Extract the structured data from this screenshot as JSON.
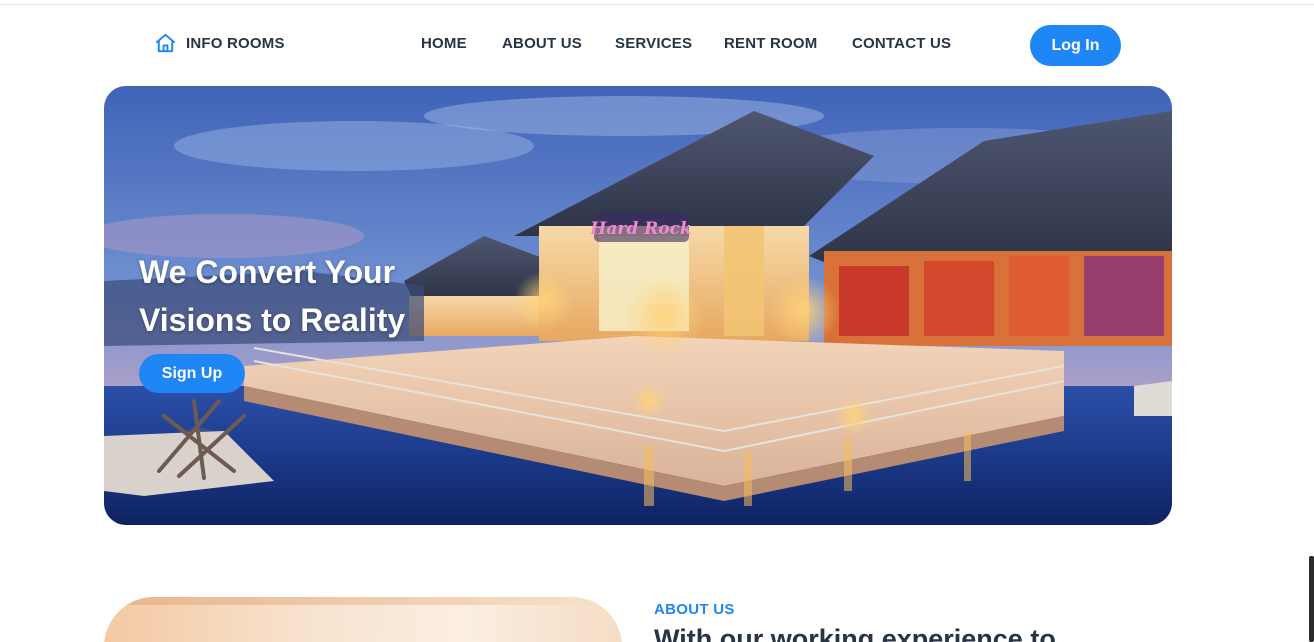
{
  "brand": {
    "name": "INFO ROOMS",
    "icon": "home-icon",
    "color": "#1f86f5"
  },
  "nav": {
    "items": [
      {
        "label": "HOME"
      },
      {
        "label": "ABOUT US"
      },
      {
        "label": "SERVICES"
      },
      {
        "label": "RENT ROOM"
      },
      {
        "label": "CONTACT US"
      }
    ],
    "login_label": "Log In"
  },
  "hero": {
    "title_line1": "We Convert Your",
    "title_line2": "Visions to Reality",
    "signup_label": "Sign Up",
    "sign_text": "Hard Rock"
  },
  "about": {
    "label": "ABOUT US",
    "heading": "With our working experience to"
  },
  "colors": {
    "accent": "#1f86f5",
    "text_dark": "#273444",
    "background": "#ffffff"
  }
}
